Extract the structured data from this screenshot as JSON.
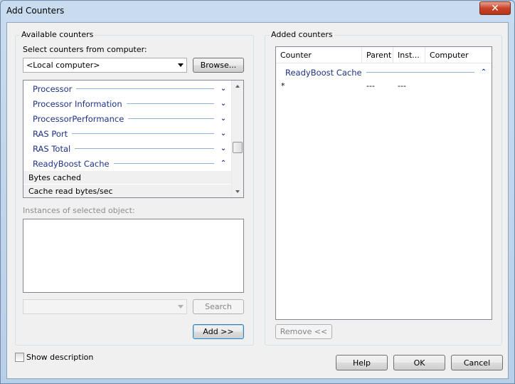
{
  "window": {
    "title": "Add Counters",
    "close_glyph": "✕"
  },
  "available": {
    "group_label": "Available counters",
    "select_label": "Select counters from computer:",
    "computer_value": "<Local computer>",
    "browse_label": "Browse...",
    "objects": [
      {
        "name": "Processor",
        "expanded": false,
        "chevron": "⌄"
      },
      {
        "name": "Processor Information",
        "expanded": false,
        "chevron": "⌄"
      },
      {
        "name": "ProcessorPerformance",
        "expanded": false,
        "chevron": "⌄"
      },
      {
        "name": "RAS Port",
        "expanded": false,
        "chevron": "⌄"
      },
      {
        "name": "RAS Total",
        "expanded": false,
        "chevron": "⌄"
      },
      {
        "name": "ReadyBoost Cache",
        "expanded": true,
        "chevron": "⌃"
      }
    ],
    "counters": [
      "Bytes cached",
      "Cache read bytes/sec"
    ],
    "instances_label": "Instances of selected object:",
    "search_label": "Search",
    "add_label": "Add >>"
  },
  "added": {
    "group_label": "Added counters",
    "columns": [
      "Counter",
      "Parent",
      "Inst...",
      "Computer"
    ],
    "object": {
      "name": "ReadyBoost Cache",
      "chevron": "⌃"
    },
    "row": {
      "counter": "*",
      "parent": "---",
      "instance": "---",
      "computer": ""
    },
    "remove_label": "Remove <<"
  },
  "footer": {
    "show_description_label": "Show description",
    "help_label": "Help",
    "ok_label": "OK",
    "cancel_label": "Cancel"
  },
  "colors": {
    "object_text": "#1e3287",
    "close_button": "#c8442a"
  }
}
